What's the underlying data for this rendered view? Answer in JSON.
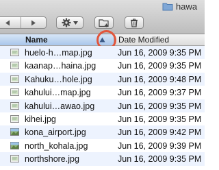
{
  "window": {
    "folder_title": "hawa"
  },
  "toolbar": {
    "back_icon": "back-arrow-icon",
    "forward_icon": "forward-arrow-icon",
    "action_icon": "gear-icon",
    "new_folder_icon": "new-folder-icon",
    "trash_icon": "trash-icon"
  },
  "columns": {
    "name": "Name",
    "date_modified": "Date Modified",
    "sort_direction": "ascending"
  },
  "files": [
    {
      "name": "huelo-h…map.jpg",
      "date": "Jun 16, 2009 9:35 PM",
      "thumb": "map"
    },
    {
      "name": "kaanap…haina.jpg",
      "date": "Jun 16, 2009 9:35 PM",
      "thumb": "map"
    },
    {
      "name": "Kahuku…hole.jpg",
      "date": "Jun 16, 2009 9:48 PM",
      "thumb": "map"
    },
    {
      "name": "kahului…map.jpg",
      "date": "Jun 16, 2009 9:37 PM",
      "thumb": "map"
    },
    {
      "name": "kahului…awao.jpg",
      "date": "Jun 16, 2009 9:35 PM",
      "thumb": "map"
    },
    {
      "name": "kihei.jpg",
      "date": "Jun 16, 2009 9:35 PM",
      "thumb": "map"
    },
    {
      "name": "kona_airport.jpg",
      "date": "Jun 16, 2009 9:42 PM",
      "thumb": "photo"
    },
    {
      "name": "north_kohala.jpg",
      "date": "Jun 16, 2009 9:39 PM",
      "thumb": "photo"
    },
    {
      "name": "northshore.jpg",
      "date": "Jun 16, 2009 9:35 PM",
      "thumb": "map"
    }
  ],
  "colors": {
    "header_selected": "#a9c6ea",
    "row_alt": "#edf3fe",
    "highlight_ring": "#e2553b"
  }
}
